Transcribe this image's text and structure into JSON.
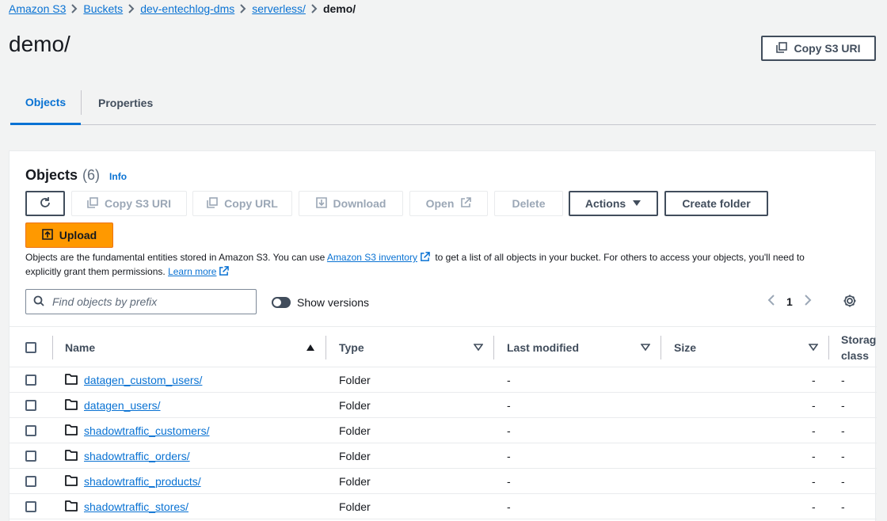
{
  "breadcrumb": [
    {
      "label": "Amazon S3"
    },
    {
      "label": "Buckets"
    },
    {
      "label": "dev-entechlog-dms"
    },
    {
      "label": "serverless/"
    }
  ],
  "breadcrumb_current": "demo/",
  "page_title": "demo/",
  "top_copy_button": "Copy S3 URI",
  "tabs": {
    "objects": "Objects",
    "properties": "Properties"
  },
  "panel": {
    "title": "Objects",
    "count": "(6)",
    "info": "Info"
  },
  "toolbar": {
    "copy_s3_uri": "Copy S3 URI",
    "copy_url": "Copy URL",
    "download": "Download",
    "open": "Open",
    "delete": "Delete",
    "actions": "Actions",
    "create_folder": "Create folder",
    "upload": "Upload"
  },
  "description": {
    "part1": "Objects are the fundamental entities stored in Amazon S3. You can use",
    "link1": "Amazon S3 inventory",
    "part2": "to get a list of all objects in your bucket. For others to access your objects, you'll need to explicitly grant them permissions.",
    "link2": "Learn more"
  },
  "search": {
    "placeholder": "Find objects by prefix"
  },
  "show_versions": "Show versions",
  "pagination": {
    "page": "1"
  },
  "table": {
    "headers": {
      "name": "Name",
      "type": "Type",
      "last_modified": "Last modified",
      "size": "Size",
      "storage_class": "Storag class"
    },
    "rows": [
      {
        "name": "datagen_custom_users/",
        "type": "Folder",
        "last_modified": "-",
        "size": "-",
        "storage_class": "-"
      },
      {
        "name": "datagen_users/",
        "type": "Folder",
        "last_modified": "-",
        "size": "-",
        "storage_class": "-"
      },
      {
        "name": "shadowtraffic_customers/",
        "type": "Folder",
        "last_modified": "-",
        "size": "-",
        "storage_class": "-"
      },
      {
        "name": "shadowtraffic_orders/",
        "type": "Folder",
        "last_modified": "-",
        "size": "-",
        "storage_class": "-"
      },
      {
        "name": "shadowtraffic_products/",
        "type": "Folder",
        "last_modified": "-",
        "size": "-",
        "storage_class": "-"
      },
      {
        "name": "shadowtraffic_stores/",
        "type": "Folder",
        "last_modified": "-",
        "size": "-",
        "storage_class": "-"
      }
    ]
  },
  "colors": {
    "primary": "#ff9900",
    "link": "#0972d3",
    "text": "#16191f",
    "disabled": "#9ba7b6"
  }
}
